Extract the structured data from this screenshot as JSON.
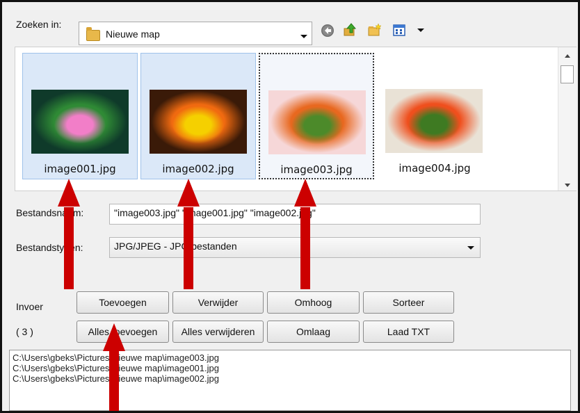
{
  "toolbar": {
    "look_in_label": "Zoeken in:",
    "folder_name": "Nieuwe map",
    "icons": [
      "back-icon",
      "up-folder-icon",
      "new-folder-icon",
      "view-menu-icon"
    ]
  },
  "files": [
    {
      "name": "image001.jpg",
      "state": "selected",
      "colors": [
        "#0f3a2a",
        "#2f8a35",
        "#f27ec8"
      ]
    },
    {
      "name": "image002.jpg",
      "state": "selected",
      "colors": [
        "#3a1a08",
        "#f06a10",
        "#f5d000"
      ]
    },
    {
      "name": "image003.jpg",
      "state": "focused",
      "colors": [
        "#f6d7d8",
        "#e8681f",
        "#4c8a2a"
      ]
    },
    {
      "name": "image004.jpg",
      "state": "normal",
      "colors": [
        "#e9e2d6",
        "#ef4f1d",
        "#3e7a22"
      ]
    }
  ],
  "filename_label": "Bestandsnaam:",
  "filename_value": "\"image003.jpg\" \"image001.jpg\" \"image002.jpg\"",
  "filetype_label": "Bestandstypen:",
  "filetype_value": "JPG/JPEG - JPG bestanden",
  "input_label": "Invoer",
  "count_label": "( 3 )",
  "buttons": {
    "add": "Toevoegen",
    "remove": "Verwijder",
    "up": "Omhoog",
    "sort": "Sorteer",
    "add_all": "Alles toevoegen",
    "remove_all": "Alles verwijderen",
    "down": "Omlaag",
    "load_txt": "Laad TXT"
  },
  "paths": [
    "C:\\Users\\gbeks\\Pictures\\Nieuwe map\\image003.jpg",
    "C:\\Users\\gbeks\\Pictures\\Nieuwe map\\image001.jpg",
    "C:\\Users\\gbeks\\Pictures\\Nieuwe map\\image002.jpg"
  ],
  "annotation_color": "#c00000"
}
